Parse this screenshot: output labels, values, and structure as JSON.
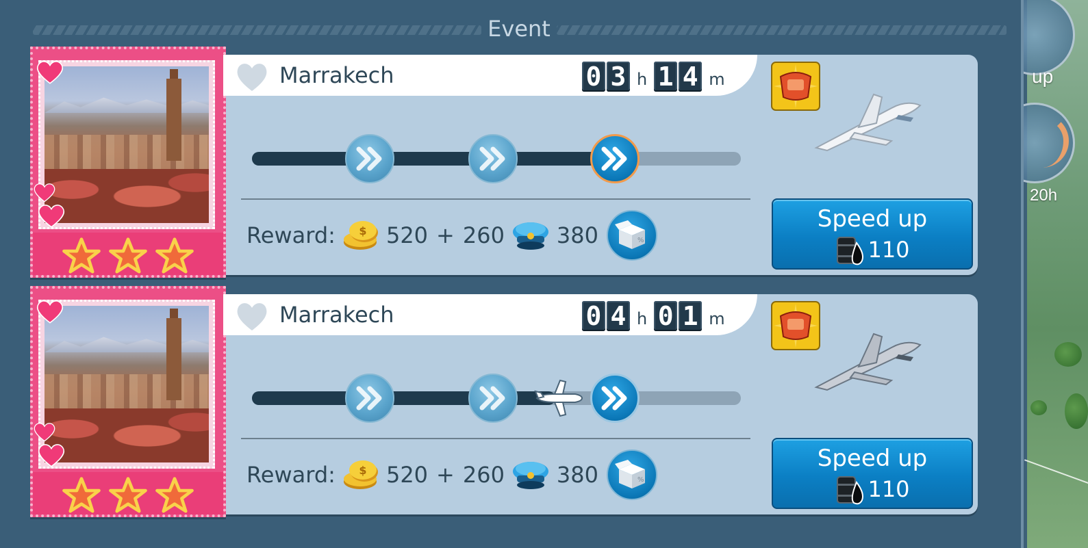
{
  "header": {
    "title": "Event"
  },
  "background": {
    "speed_text": "up",
    "timer_text": "20h"
  },
  "flights": [
    {
      "city": "Marrakech",
      "timer": {
        "hours": [
          "0",
          "3"
        ],
        "hours_unit": "h",
        "minutes": [
          "1",
          "4"
        ],
        "minutes_unit": "m"
      },
      "stars": 3,
      "progress_fraction": 0.75,
      "plane_marker_visible": false,
      "reward": {
        "label": "Reward:",
        "coins": "520",
        "plus": "+",
        "bonus": "260",
        "crew": "380"
      },
      "speed_up": {
        "label": "Speed up",
        "cost": "110"
      },
      "jet_color": "#f2f4f7"
    },
    {
      "city": "Marrakech",
      "timer": {
        "hours": [
          "0",
          "4"
        ],
        "hours_unit": "h",
        "minutes": [
          "0",
          "1"
        ],
        "minutes_unit": "m"
      },
      "stars": 3,
      "progress_fraction": 0.62,
      "plane_marker_visible": true,
      "reward": {
        "label": "Reward:",
        "coins": "520",
        "plus": "+",
        "bonus": "260",
        "crew": "380"
      },
      "speed_up": {
        "label": "Speed up",
        "cost": "110"
      },
      "jet_color": "#c9ced6"
    }
  ],
  "colors": {
    "panel": "#3a5e78",
    "card": "#b6cde0",
    "stamp_pink": "#ec4f86",
    "button_blue": "#0b7fc4",
    "active_ring": "#f29a4a",
    "track_fill": "#1e3a4d",
    "track_empty": "#8ea4b6"
  }
}
